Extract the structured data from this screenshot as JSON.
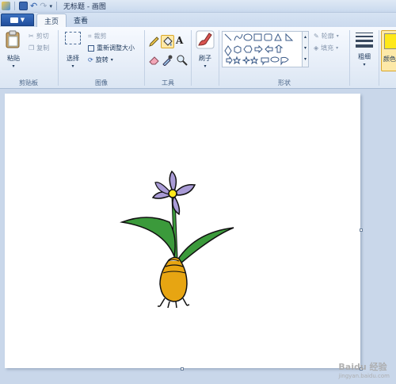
{
  "window": {
    "title": "无标题 - 画图"
  },
  "tabs": {
    "file_label": "▼",
    "home": "主页",
    "view": "查看"
  },
  "clipboard": {
    "paste": "粘贴",
    "cut": "剪切",
    "copy": "复制",
    "group": "剪贴板"
  },
  "image": {
    "select": "选择",
    "crop": "裁剪",
    "resize": "重新调整大小",
    "rotate": "旋转",
    "group": "图像"
  },
  "tools": {
    "group": "工具"
  },
  "brushes": {
    "label": "刷子"
  },
  "shapes": {
    "outline": "轮廓",
    "fill": "填充",
    "group": "形状"
  },
  "size": {
    "label": "粗细"
  },
  "colors": {
    "label": "颜色"
  },
  "watermark": {
    "text": "Baidu 经验",
    "sub": "jingyan.baidu.com"
  },
  "palette": {
    "accent": "#1f4d9c",
    "petal": "#a99bd6",
    "leaf": "#3b9a3b",
    "bulb": "#e7a512",
    "center": "#ffe81a"
  }
}
